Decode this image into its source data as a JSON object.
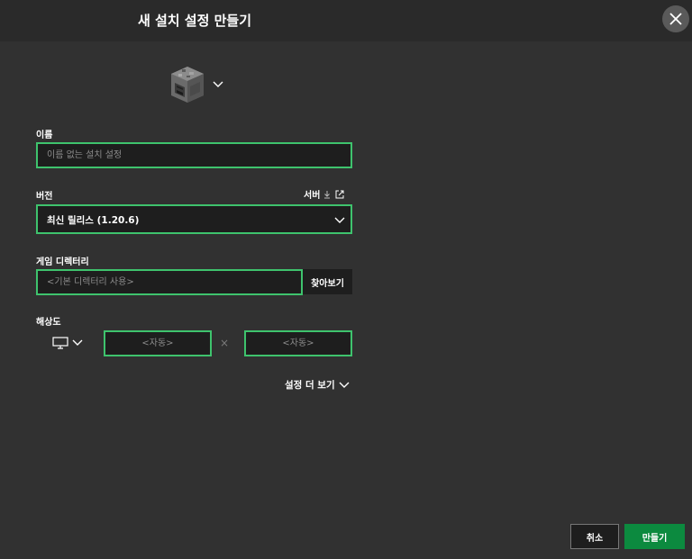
{
  "header": {
    "title": "새 설치 설정 만들기"
  },
  "form": {
    "name": {
      "label": "이름",
      "placeholder": "이름 없는 설치 설정",
      "value": ""
    },
    "version": {
      "label": "버전",
      "server_label": "서버",
      "selected": "최신 릴리스 (1.20.6)"
    },
    "game_directory": {
      "label": "게임 디렉터리",
      "placeholder": "<기본 디렉터리 사용>",
      "browse_label": "찾아보기"
    },
    "resolution": {
      "label": "해상도",
      "width_placeholder": "<자동>",
      "height_placeholder": "<자동>",
      "separator": "×"
    },
    "more_settings_label": "설정 더 보기"
  },
  "footer": {
    "cancel_label": "취소",
    "create_label": "만들기"
  },
  "colors": {
    "accent_green": "#3ec36d",
    "button_green": "#0c8a3f",
    "background": "#313131",
    "field_bg": "#1e1e1e"
  },
  "icons": [
    "close-icon",
    "furnace-icon",
    "chevron-down-icon",
    "download-icon",
    "external-link-icon",
    "monitor-icon"
  ]
}
